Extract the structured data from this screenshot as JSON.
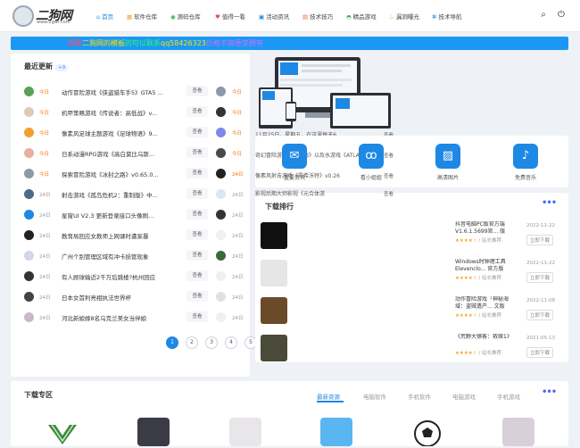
{
  "site": {
    "logo_text": "二狗网",
    "logo_url": "www.2gwl.com"
  },
  "nav": [
    {
      "icon": "home-icon",
      "glyph": "⌂",
      "label": "首页"
    },
    {
      "icon": "software-icon",
      "glyph": "▦",
      "label": "软件仓库"
    },
    {
      "icon": "source-icon",
      "glyph": "◉",
      "label": "源码仓库"
    },
    {
      "icon": "heart-icon",
      "glyph": "♥",
      "label": "值得一看"
    },
    {
      "icon": "activity-icon",
      "glyph": "▣",
      "label": "活动资讯"
    },
    {
      "icon": "tips-icon",
      "glyph": "▤",
      "label": "技术技巧"
    },
    {
      "icon": "game-icon",
      "glyph": "◓",
      "label": "精品游戏"
    },
    {
      "icon": "flame-icon",
      "glyph": "♨",
      "label": "漏洞曝光"
    },
    {
      "icon": "gear-icon",
      "glyph": "✻",
      "label": "技术导航"
    }
  ],
  "banner": {
    "p1": "需要",
    "p2": "二狗网的模板",
    "p3": "的可以联系",
    "p4": "qq58426323",
    "p5": "价格不高便宜拥有"
  },
  "recent": {
    "title": "最近更新",
    "badge": "+9",
    "button_label": "查看",
    "rows": [
      {
        "date": "今日",
        "title": "动作冒险游戏《侠盗猎车手5》GTA5 ...",
        "date2": "今日",
        "hot": true
      },
      {
        "date": "今日",
        "title": "机甲策略游戏《传说者：高低战》v...",
        "date2": "今日",
        "hot": true
      },
      {
        "date": "今日",
        "title": "像素风足球主题游戏《足球物语》9...",
        "date2": "今日",
        "hot": true
      },
      {
        "date": "今日",
        "title": "日系动漫RPG游戏《高白莫比乌斯...",
        "date2": "今日",
        "hot": true
      },
      {
        "date": "今日",
        "title": "探索冒险游戏《冰封之路》v0.65.0...",
        "date2": "24日",
        "hot": true
      },
      {
        "date": "24日",
        "title": "射击游戏《孤岛危机2：重制版》中...",
        "date2": "24日",
        "hot": false
      },
      {
        "date": "24日",
        "title": "星窗UI V2.3 更新登录接口头像刷...",
        "date2": "24日",
        "hot": false
      },
      {
        "date": "24日",
        "title": "教育局回应女教师上网课时遭家暴",
        "date2": "24日",
        "hot": false
      },
      {
        "date": "24日",
        "title": "广州个别管理区域有冲卡损管现象",
        "date2": "24日",
        "hot": false
      },
      {
        "date": "24日",
        "title": "有人顾球输近2千万后跳楼?杭州回应",
        "date2": "24日",
        "hot": false
      },
      {
        "date": "24日",
        "title": "日本女首利亮相执法世界杯",
        "date2": "24日",
        "hot": false
      },
      {
        "date": "24日",
        "title": "河北新娘嫁8名乌克兰美女当伴娘",
        "date2": "24日",
        "hot": false
      }
    ],
    "pages": [
      "1",
      "2",
      "3",
      "4",
      "5"
    ]
  },
  "overlay": {
    "line1": "11月25日，星期五，在这里每天6...",
    "line1_btn": "查看",
    "line2": "奇幻冒险游戏《星之海》以及水游戏《ATLA...",
    "line2_btn": "查看",
    "line3": "像素风射击游戏《零希沃特》v0.26",
    "line3_btn": "查看",
    "line4": "影视后期大师影视《元合体游",
    "line4_btn": "查看"
  },
  "quick_links": [
    {
      "icon": "wechat-icon",
      "glyph": "✉",
      "label": "重要资讯"
    },
    {
      "icon": "mini-program-icon",
      "glyph": "ꝏ",
      "label": "看小姐姐"
    },
    {
      "icon": "image-icon",
      "glyph": "▨",
      "label": "高清图片"
    },
    {
      "icon": "music-icon",
      "glyph": "♪",
      "label": "免费音乐"
    }
  ],
  "downloads": {
    "title": "下载排行",
    "author_label": "/ 站长推荐",
    "download_label": "立即下载",
    "items": [
      {
        "name": "抖音电脑PC版官方端V1.6.1.5699官... 版",
        "date": "2022-11-22",
        "color": "#111"
      },
      {
        "name": "Windows时钟理工具Elevenclo... 官方版",
        "date": "2022-11-22",
        "color": "#e6e6e6"
      },
      {
        "name": "动作冒险游戏「神秘海域：盗贼遗产... 文版",
        "date": "2022-11-08",
        "color": "#6b4a2a"
      },
      {
        "name": "《荒野大镖客：救赎1》",
        "date": "2021-05-13",
        "color": "#4a4a3a"
      }
    ]
  },
  "download_zone": {
    "title": "下载专区",
    "tabs": [
      "最新资源",
      "电脑软件",
      "手机软件",
      "电脑游戏",
      "手机游戏"
    ]
  },
  "colors": {
    "accent": "#1e88e5",
    "hot": "#ff6a00"
  }
}
